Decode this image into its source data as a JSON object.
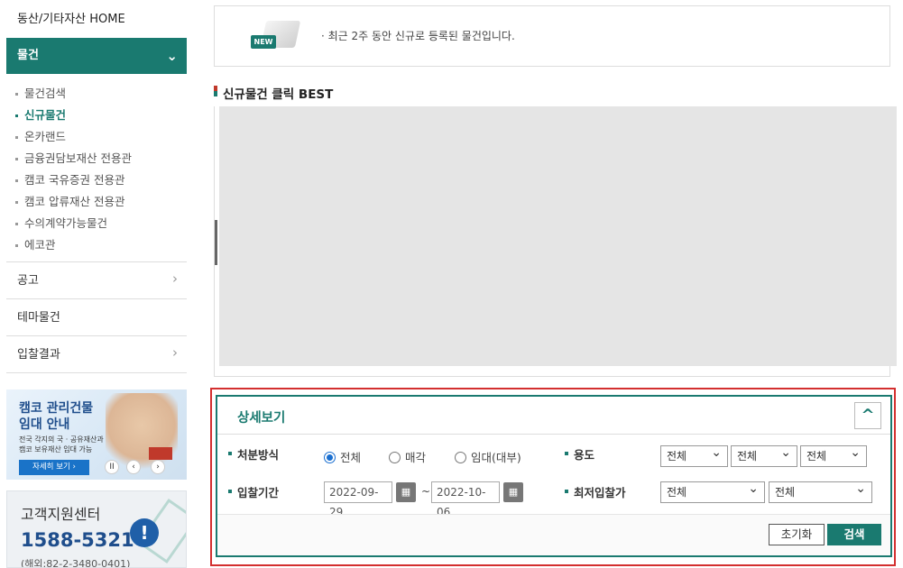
{
  "sidebar": {
    "home": "동산/기타자산 HOME",
    "active_section": "물건",
    "sub_items": [
      {
        "label": "물건검색",
        "active": false
      },
      {
        "label": "신규물건",
        "active": true
      },
      {
        "label": "온카랜드",
        "active": false
      },
      {
        "label": "금융권담보재산 전용관",
        "active": false
      },
      {
        "label": "캠코 국유증권 전용관",
        "active": false
      },
      {
        "label": "캠코 압류재산 전용관",
        "active": false
      },
      {
        "label": "수의계약가능물건",
        "active": false
      },
      {
        "label": "에코관",
        "active": false
      }
    ],
    "menus": [
      {
        "label": "공고",
        "has_arrow": true
      },
      {
        "label": "테마물건",
        "has_arrow": false
      },
      {
        "label": "입찰결과",
        "has_arrow": true
      }
    ]
  },
  "banner": {
    "title_line1": "캠코 관리건물",
    "title_line2": "임대 안내",
    "desc_line1": "전국 각지의 국 · 공유재산과",
    "desc_line2": "캠코 보유재산 임대 가능",
    "button": "자세히 보기 ›",
    "pause": "II",
    "prev": "‹",
    "next": "›"
  },
  "support": {
    "title": "고객지원센터",
    "phone": "1588-5321",
    "overseas": "(해외:82-2-3480-0401)"
  },
  "notice": {
    "tag": "NEW",
    "text": "· 최근 2주 동안 신규로 등록된 물건입니다."
  },
  "best": {
    "title": "신규물건 클릭 BEST"
  },
  "detail": {
    "title": "상세보기",
    "toggle": "^",
    "disposal": {
      "label": "처분방식",
      "options": [
        {
          "label": "전체",
          "checked": true
        },
        {
          "label": "매각",
          "checked": false
        },
        {
          "label": "임대(대부)",
          "checked": false
        }
      ]
    },
    "usage": {
      "label": "용도",
      "selects": [
        "전체",
        "전체",
        "전체"
      ]
    },
    "period": {
      "label": "입찰기간",
      "start": "2022-09-29",
      "separator": "~",
      "end": "2022-10-06"
    },
    "min_price": {
      "label": "최저입찰가",
      "selects": [
        "전체",
        "전체"
      ]
    },
    "buttons": {
      "reset": "초기화",
      "search": "검색"
    }
  },
  "colors": {
    "primary": "#1a7a70",
    "highlight_border": "#d32f2f",
    "banner_blue": "#1f4e8c"
  }
}
